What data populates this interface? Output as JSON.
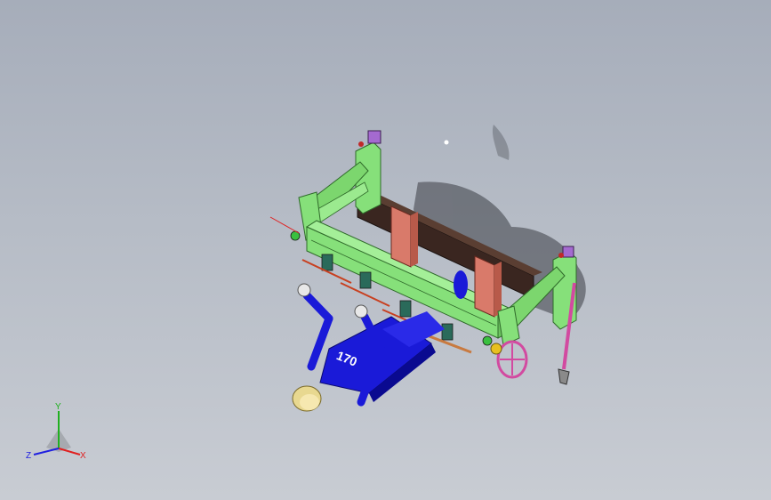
{
  "viewport": {
    "background_top": "#a6adba",
    "background_bottom": "#c8ccd3"
  },
  "model": {
    "frame_color": "#86e07a",
    "dark_beam_color": "#3d2a22",
    "post_color": "#d97a6a",
    "figure_color": "#1a1ad8",
    "handwheel_color": "#d24aa0",
    "helmet_color": "#e8d890",
    "figure_label": "170"
  },
  "triad": {
    "x_label": "X",
    "y_label": "Y",
    "z_label": "Z",
    "x_color": "#e02020",
    "y_color": "#20b020",
    "z_color": "#2020e0"
  }
}
